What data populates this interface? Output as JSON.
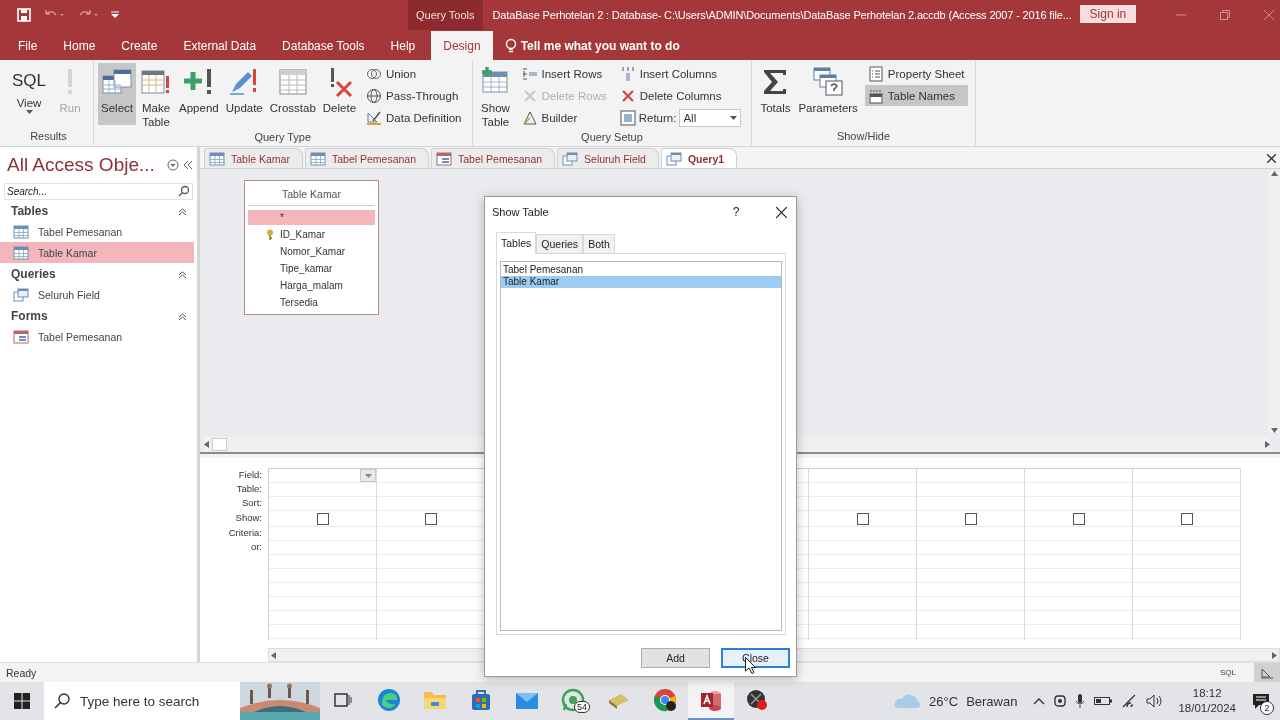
{
  "title_bar": {
    "context_label": "Query Tools",
    "title": "DataBase Perhotelan 2 : Database- C:\\Users\\ADMIN\\Documents\\DataBase Perhotelan 2.accdb (Access 2007 - 2016 file...",
    "sign_in": "Sign in"
  },
  "menu_tabs": [
    {
      "label": "File",
      "selected": false
    },
    {
      "label": "Home",
      "selected": false
    },
    {
      "label": "Create",
      "selected": false
    },
    {
      "label": "External Data",
      "selected": false
    },
    {
      "label": "Database Tools",
      "selected": false
    },
    {
      "label": "Help",
      "selected": false
    },
    {
      "label": "Design",
      "selected": true
    }
  ],
  "tell_me": "Tell me what you want to do",
  "ribbon": [
    {
      "label": "Results",
      "items": [
        {
          "kind": "view",
          "glyph": "SQL",
          "label": "View"
        },
        {
          "kind": "large",
          "label": "Run",
          "disabled": true,
          "selected": false
        }
      ]
    },
    {
      "label": "Query Type",
      "items": [
        {
          "kind": "large",
          "label": "Select",
          "disabled": false,
          "selected": true
        },
        {
          "kind": "large",
          "label": "Make Table",
          "disabled": false,
          "selected": false
        },
        {
          "kind": "large",
          "label": "Append",
          "disabled": false,
          "selected": false
        },
        {
          "kind": "large",
          "label": "Update",
          "disabled": false,
          "selected": false
        },
        {
          "kind": "large",
          "label": "Crosstab",
          "disabled": false,
          "selected": false
        },
        {
          "kind": "large",
          "label": "Delete",
          "disabled": false,
          "selected": false
        },
        {
          "kind": "stack",
          "items": [
            {
              "kind": "small",
              "label": "Union",
              "disabled": false,
              "selected": false
            },
            {
              "kind": "small",
              "label": "Pass-Through",
              "disabled": false,
              "selected": false
            },
            {
              "kind": "small",
              "label": "Data Definition",
              "disabled": false,
              "selected": false
            }
          ]
        }
      ]
    },
    {
      "label": "Query Setup",
      "items": [
        {
          "kind": "large",
          "label": "Show Table",
          "disabled": false,
          "selected": false
        },
        {
          "kind": "stack",
          "items": [
            {
              "kind": "small",
              "label": "Insert Rows",
              "disabled": false,
              "selected": false
            },
            {
              "kind": "small",
              "label": "Delete Rows",
              "disabled": true,
              "selected": false
            },
            {
              "kind": "small",
              "label": "Builder",
              "disabled": false,
              "selected": false
            }
          ]
        },
        {
          "kind": "stack",
          "items": [
            {
              "kind": "small",
              "label": "Insert Columns",
              "disabled": false,
              "selected": false
            },
            {
              "kind": "small",
              "label": "Delete Columns",
              "disabled": false,
              "selected": false
            },
            {
              "kind": "combo",
              "label": "Return:",
              "value": "All"
            }
          ]
        }
      ]
    },
    {
      "label": "Show/Hide",
      "items": [
        {
          "kind": "large",
          "label": "Totals",
          "disabled": false,
          "selected": false
        },
        {
          "kind": "large",
          "label": "Parameters",
          "disabled": false,
          "selected": false
        },
        {
          "kind": "stack",
          "items": [
            {
              "kind": "small",
              "label": "Property Sheet",
              "disabled": false,
              "selected": false
            },
            {
              "kind": "small",
              "label": "Table Names",
              "disabled": false,
              "selected": true
            }
          ]
        }
      ]
    }
  ],
  "nav_pane": {
    "title": "All Access Obje...",
    "search_placeholder": "Search...",
    "sections": [
      {
        "label": "Tables",
        "items": [
          {
            "label": "Tabel Pemesanan",
            "kind": "table",
            "selected": false
          },
          {
            "label": "Table Kamar",
            "kind": "table",
            "selected": true
          }
        ]
      },
      {
        "label": "Queries",
        "items": [
          {
            "label": "Seluruh Field",
            "kind": "query",
            "selected": false
          }
        ]
      },
      {
        "label": "Forms",
        "items": [
          {
            "label": "Tabel Pemesanan",
            "kind": "form",
            "selected": false
          }
        ]
      }
    ]
  },
  "doc_tabs": [
    {
      "label": "Table Kamar",
      "kind": "table",
      "selected": false
    },
    {
      "label": "Tabel Pemesanan",
      "kind": "table",
      "selected": false
    },
    {
      "label": "Tabel Pemesanan",
      "kind": "form",
      "selected": false
    },
    {
      "label": "Seluruh Field",
      "kind": "query",
      "selected": false
    },
    {
      "label": "Query1",
      "kind": "query",
      "selected": true
    }
  ],
  "table_box": {
    "title": "Table Kamar",
    "fields": [
      {
        "name": "*",
        "selected": true,
        "primary_key": false
      },
      {
        "name": "ID_Kamar",
        "selected": false,
        "primary_key": true
      },
      {
        "name": "Nomor_Kamar",
        "selected": false,
        "primary_key": false
      },
      {
        "name": "Tipe_kamar",
        "selected": false,
        "primary_key": false
      },
      {
        "name": "Harga_malam",
        "selected": false,
        "primary_key": false
      },
      {
        "name": "Tersedia",
        "selected": false,
        "primary_key": false
      }
    ]
  },
  "design_grid": {
    "row_labels": [
      "Field:",
      "Table:",
      "Sort:",
      "Show:",
      "Criteria:",
      "or:"
    ],
    "columns": [
      {
        "focused": true,
        "show_checked": false
      },
      {
        "focused": false,
        "show_checked": false
      },
      {},
      {},
      {},
      {
        "focused": false,
        "show_checked": false
      },
      {
        "focused": false,
        "show_checked": false
      },
      {
        "focused": false,
        "show_checked": false
      },
      {
        "focused": false,
        "show_checked": false
      }
    ]
  },
  "dialog": {
    "title": "Show Table",
    "help": "?",
    "tabs": [
      {
        "label": "Tables",
        "selected": true
      },
      {
        "label": "Queries",
        "selected": false
      },
      {
        "label": "Both",
        "selected": false
      }
    ],
    "items": [
      {
        "label": "Tabel Pemesanan",
        "selected": false
      },
      {
        "label": "Table Kamar",
        "selected": true
      }
    ],
    "buttons": [
      {
        "label": "Add",
        "focused": false
      },
      {
        "label": "Close",
        "focused": true
      }
    ]
  },
  "status_bar": {
    "text": "Ready",
    "view_label": "SQL"
  },
  "taskbar": {
    "search_placeholder": "Type here to search",
    "apps": [
      {
        "selected": false
      },
      {
        "selected": false
      },
      {
        "selected": false
      },
      {
        "selected": false
      },
      {
        "selected": false
      },
      {
        "selected": false,
        "badge": "54"
      },
      {
        "selected": false
      },
      {
        "selected": false
      },
      {
        "selected": true
      },
      {
        "selected": false
      }
    ],
    "weather": {
      "temperature": "26°C",
      "condition": "Berawan"
    },
    "time": "18:12",
    "date": "18/01/2024",
    "notification_count": "2"
  }
}
